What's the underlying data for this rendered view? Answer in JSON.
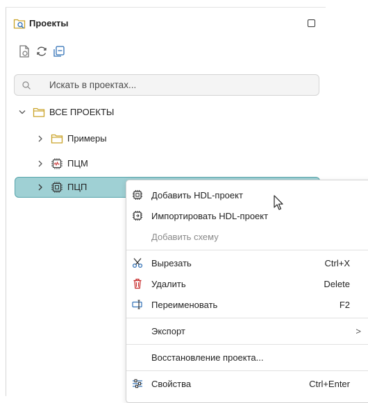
{
  "panel": {
    "title": "Проекты",
    "title_icon": "projects-icon",
    "maximize_icon": "maximize-icon"
  },
  "toolbar": {
    "items": [
      {
        "name": "new-file-icon"
      },
      {
        "name": "refresh-icon"
      },
      {
        "name": "collapse-all-icon"
      }
    ]
  },
  "search": {
    "placeholder": "Искать в проектах..."
  },
  "tree": {
    "root_label": "ВСЕ ПРОЕКТЫ",
    "items": [
      {
        "label": "Примеры",
        "icon": "folder-icon"
      },
      {
        "label": "ПЦМ",
        "icon": "chip-signal-icon"
      },
      {
        "label": "ПЦП",
        "icon": "chip-icon"
      }
    ]
  },
  "context_menu": {
    "items": [
      {
        "label": "Добавить HDL-проект",
        "icon": "chip-add-icon",
        "shortcut": ""
      },
      {
        "label": "Импортировать HDL-проект",
        "icon": "chip-import-icon",
        "shortcut": ""
      },
      {
        "label": "Добавить схему",
        "icon": "",
        "shortcut": "",
        "disabled": true
      },
      {
        "label": "Вырезать",
        "icon": "scissors-icon",
        "shortcut": "Ctrl+X"
      },
      {
        "label": "Удалить",
        "icon": "trash-icon",
        "shortcut": "Delete"
      },
      {
        "label": "Переименовать",
        "icon": "rename-icon",
        "shortcut": "F2"
      },
      {
        "label": "Экспорт",
        "icon": "",
        "shortcut": "",
        "submenu": ">"
      },
      {
        "label": "Восстановление проекта...",
        "icon": "",
        "shortcut": ""
      },
      {
        "label": "Свойства",
        "icon": "settings-sliders-icon",
        "shortcut": "Ctrl+Enter"
      }
    ]
  },
  "colors": {
    "selection_bg": "#9fd0d4",
    "selection_border": "#55a3aa",
    "folder": "#c9a227",
    "delete_red": "#c62828",
    "accent_blue": "#2f6fb5"
  }
}
